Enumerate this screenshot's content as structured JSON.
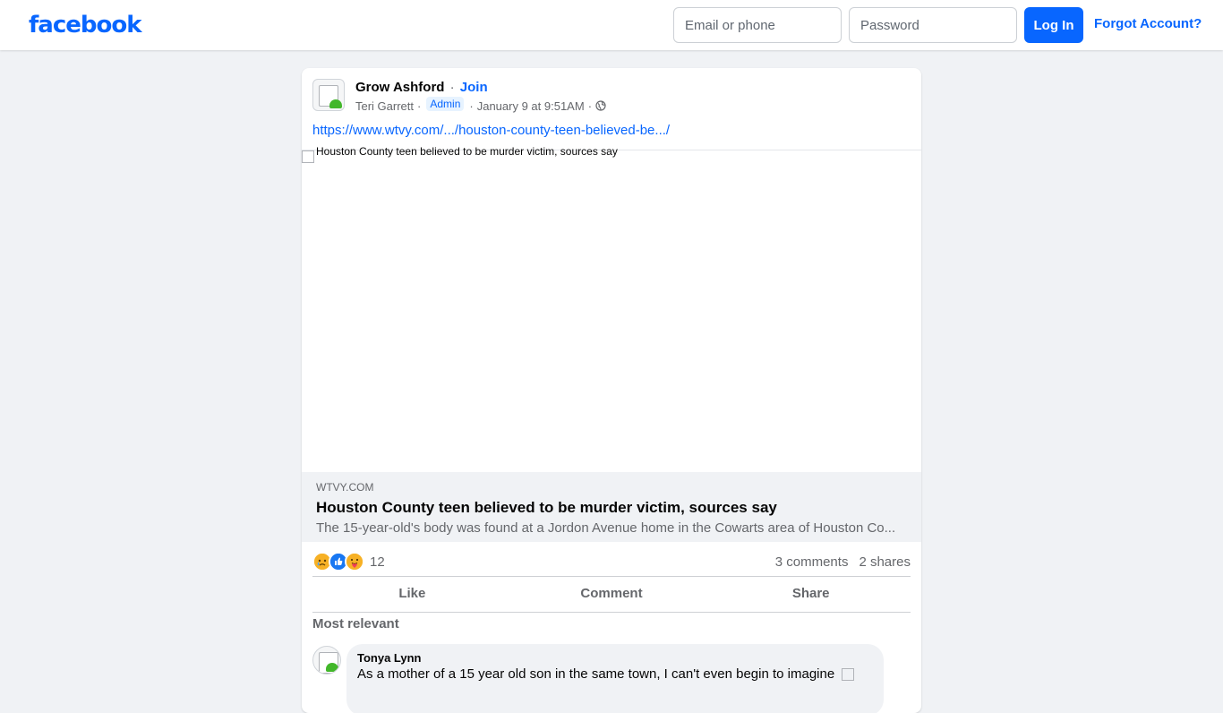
{
  "header": {
    "logo": "facebook",
    "email_placeholder": "Email or phone",
    "password_placeholder": "Password",
    "login_label": "Log In",
    "forgot_label": "Forgot Account?"
  },
  "post": {
    "group_name": "Grow Ashford",
    "separator": "·",
    "join_label": "Join",
    "author": "Teri Garrett",
    "badge": "Admin",
    "timestamp": "January 9 at 9:51AM",
    "privacy_icon": "globe-icon",
    "link_url": "https://www.wtvy.com/.../houston-county-teen-believed-be.../",
    "image_alt": "Houston County teen believed to be murder victim, sources say",
    "link_card": {
      "domain": "WTVY.COM",
      "title": "Houston County teen believed to be murder victim, sources say",
      "description": "The 15-year-old's body was found at a Jordon Avenue home in the Cowarts area of Houston Co..."
    },
    "reactions": {
      "icons": [
        "sad-icon",
        "like-icon",
        "care-icon"
      ],
      "count": "12",
      "comments": "3 comments",
      "shares": "2 shares"
    },
    "actions": {
      "like": "Like",
      "comment": "Comment",
      "share": "Share"
    },
    "comments_filter": "Most relevant",
    "comments": [
      {
        "author": "Tonya Lynn",
        "text": "As a mother of a 15 year old son in the same town, I can't even begin to imagine"
      }
    ]
  },
  "colors": {
    "brand": "#0866ff",
    "background": "#f0f2f5"
  }
}
